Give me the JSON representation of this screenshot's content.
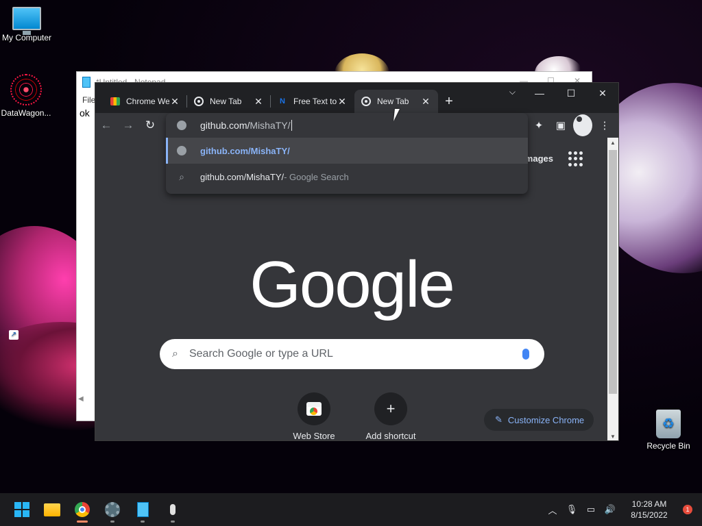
{
  "desktop": {
    "icons": [
      {
        "label": "My Computer",
        "icon": "monitor-icon"
      },
      {
        "label": "DataWagon...",
        "icon": "mandala-shortcut-icon"
      },
      {
        "label": "Recycle Bin",
        "icon": "recycle-bin-icon"
      }
    ]
  },
  "notepad": {
    "title": "*Untitled - Notepad",
    "menu": "File",
    "content": "ok"
  },
  "chrome": {
    "tabs": [
      {
        "label": "Chrome Web Store",
        "favicon": "web-store-icon",
        "active": false
      },
      {
        "label": "New Tab",
        "favicon": "chrome-icon",
        "active": false
      },
      {
        "label": "Free Text to Speech",
        "favicon": "n-logo-icon",
        "active": false
      },
      {
        "label": "New Tab",
        "favicon": "chrome-icon",
        "active": true
      }
    ],
    "omnibox": {
      "typed_host": "github.com/",
      "typed_path": "MishaTY/",
      "suggestions": [
        {
          "text": "github.com/MishaTY/",
          "type": "url",
          "selected": true
        },
        {
          "text": "github.com/MishaTY/",
          "suffix": " - Google Search",
          "type": "search",
          "selected": false
        }
      ]
    },
    "ntp": {
      "images_link": "Images",
      "logo": "Google",
      "search_placeholder": "Search Google or type a URL",
      "shortcuts": [
        {
          "label": "Web Store",
          "icon": "web-store-icon"
        },
        {
          "label": "Add shortcut",
          "icon": "plus-icon"
        }
      ],
      "customize_label": "Customize Chrome"
    },
    "colors": {
      "frame": "#202124",
      "toolbar": "#35363a",
      "link": "#8ab4f8"
    }
  },
  "taskbar": {
    "apps": [
      {
        "name": "Start",
        "icon": "windows-logo-icon"
      },
      {
        "name": "File Explorer",
        "icon": "folder-icon"
      },
      {
        "name": "Google Chrome",
        "icon": "chrome-icon"
      },
      {
        "name": "Settings",
        "icon": "gear-icon"
      },
      {
        "name": "Notepad",
        "icon": "notepad-icon"
      },
      {
        "name": "Voice Recorder",
        "icon": "microphone-icon"
      }
    ],
    "clock": {
      "time": "10:28 AM",
      "date": "8/15/2022"
    },
    "notification_count": "1"
  }
}
